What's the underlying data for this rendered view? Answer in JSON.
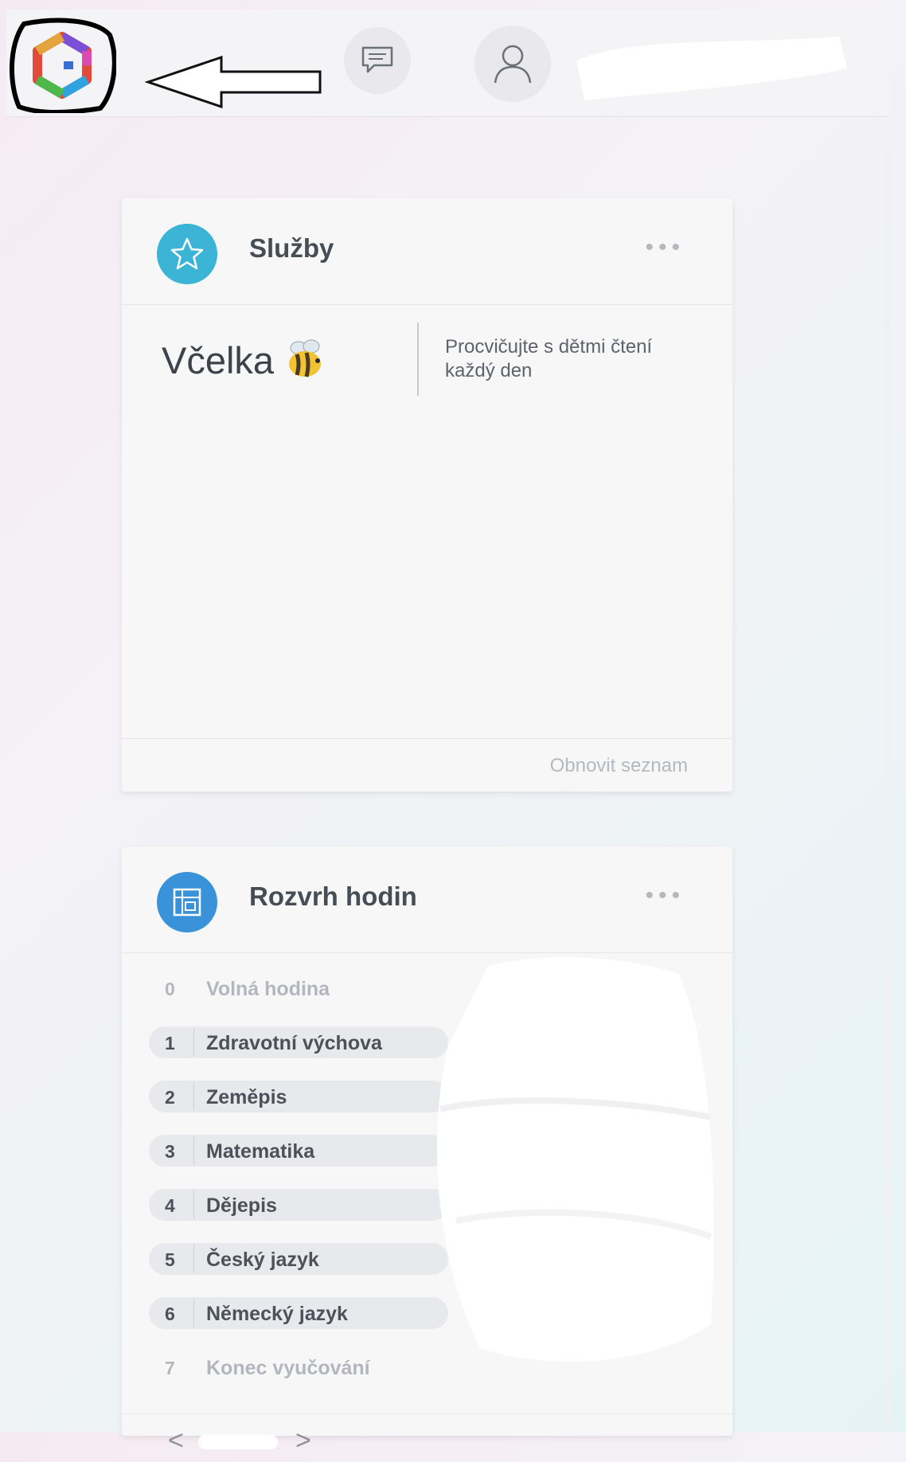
{
  "header": {
    "logo_icon": "edookit-logo-icon",
    "messages_icon": "chat-bubble-icon",
    "profile_icon": "user-icon"
  },
  "services": {
    "title": "Služby",
    "more": "•••",
    "item_name": "Včelka",
    "item_description": "Procvičujte s dětmi čtení každý den",
    "refresh": "Obnovit seznam",
    "accent": "#3bb4d6"
  },
  "schedule": {
    "title": "Rozvrh hodin",
    "more": "•••",
    "accent": "#3a93d8",
    "lessons": [
      {
        "num": "0",
        "name": "Volná hodina"
      },
      {
        "num": "1",
        "name": "Zdravotní výchova"
      },
      {
        "num": "2",
        "name": "Zeměpis"
      },
      {
        "num": "3",
        "name": "Matematika"
      },
      {
        "num": "4",
        "name": "Dějepis"
      },
      {
        "num": "5",
        "name": "Český jazyk"
      },
      {
        "num": "6",
        "name": "Německý jazyk"
      },
      {
        "num": "7",
        "name": "Konec vyučování"
      }
    ],
    "prev": "<",
    "next": ">"
  }
}
